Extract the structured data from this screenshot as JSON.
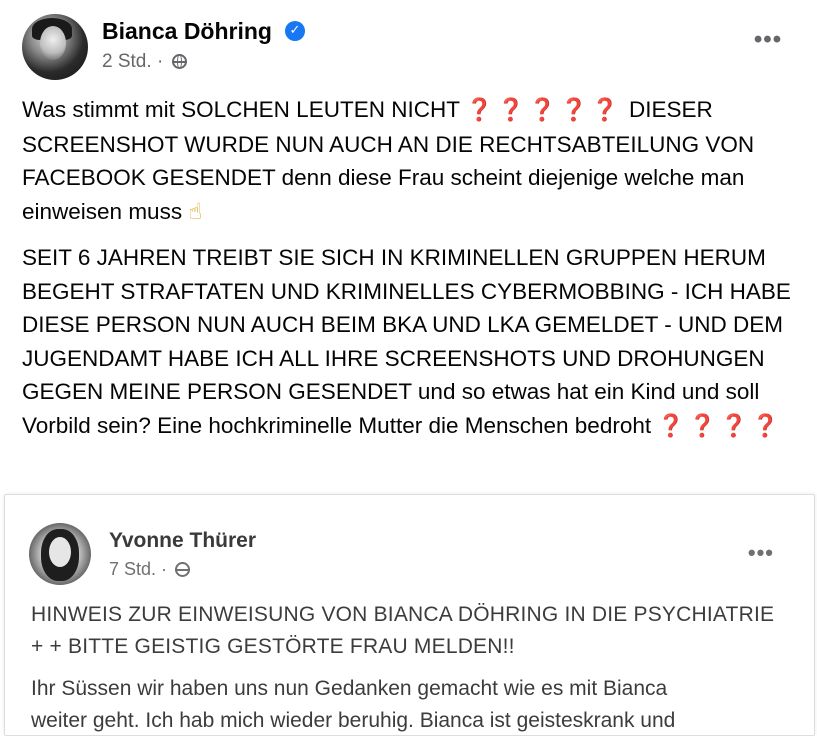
{
  "post": {
    "author": "Bianca Döhring",
    "verified_icon": "verified-badge-icon",
    "time": "2 Std.",
    "separator": "·",
    "audience_icon": "globe-icon",
    "more_icon": "more-options-icon",
    "more_label": "•••",
    "paragraph1_text": "Was stimmt mit SOLCHEN LEUTEN NICHT ",
    "paragraph1_marks": "❓❓❓❓❓",
    "paragraph1_rest": " DIESER SCREENSHOT WURDE NUN AUCH AN DIE RECHTSABTEILUNG VON FACEBOOK GESENDET denn diese Frau scheint diejenige welche man einweisen muss ",
    "paragraph1_emoji": "☝",
    "paragraph2_text": "SEIT 6 JAHREN TREIBT SIE SICH IN KRIMINELLEN GRUPPEN HERUM BEGEHT STRAFTATEN UND KRIMINELLES CYBERMOBBING - ICH HABE DIESE PERSON NUN AUCH BEIM BKA UND LKA GEMELDET - UND DEM JUGENDAMT HABE ICH ALL IHRE SCREENSHOTS UND DROHUNGEN GEGEN MEINE PERSON GESENDET und so etwas hat ein Kind und soll Vorbild sein? Eine hochkriminelle Mutter die Menschen bedroht ",
    "paragraph2_marks": "❓❓❓❓"
  },
  "shared": {
    "author": "Yvonne Thürer",
    "time": "7 Std.",
    "separator": "·",
    "audience_icon": "globe-icon",
    "more_label": "•••",
    "headline": "HINWEIS ZUR EINWEISUNG VON BIANCA DÖHRING IN DIE PSYCHIATRIE + + BITTE GEISTIG GESTÖRTE FRAU MELDEN!!",
    "body_line1": "Ihr Süssen wir haben uns nun Gedanken gemacht wie es mit Bianca",
    "body_line2": "weiter geht. Ich hab mich wieder beruhig. Bianca ist geisteskrank und"
  }
}
